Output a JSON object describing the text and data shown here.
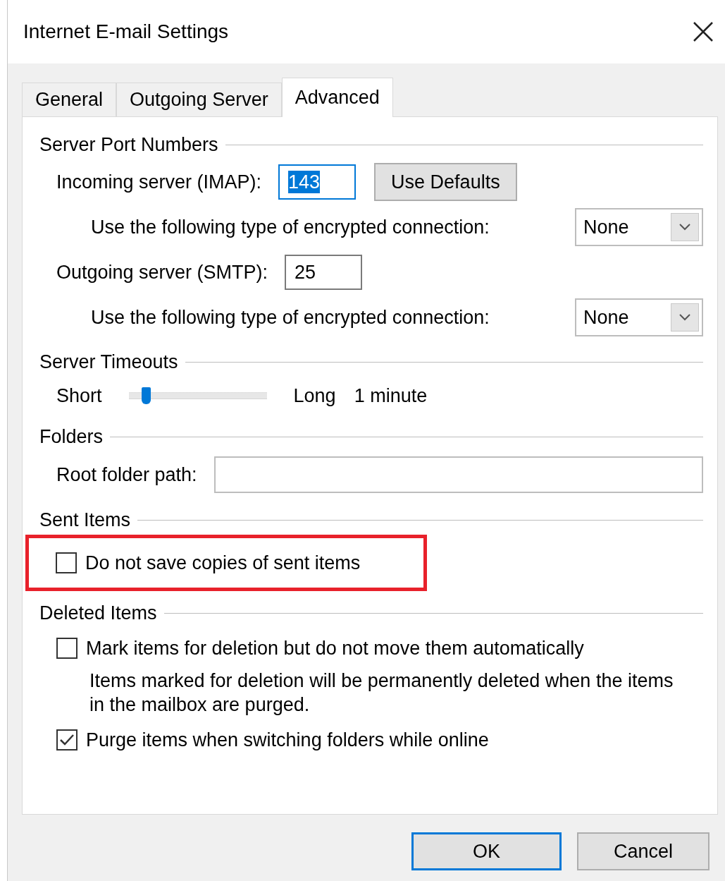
{
  "window": {
    "title": "Internet E-mail Settings"
  },
  "tabs": [
    {
      "label": "General",
      "selected": false
    },
    {
      "label": "Outgoing Server",
      "selected": false
    },
    {
      "label": "Advanced",
      "selected": true
    }
  ],
  "sections": [
    {
      "title": "Server Port Numbers",
      "rows": [
        {
          "kind": "port",
          "label": "Incoming server (IMAP):",
          "value": "143",
          "value_selected": true,
          "button": "Use Defaults"
        },
        {
          "kind": "select",
          "label": "Use the following type of encrypted connection:",
          "value": "None"
        },
        {
          "kind": "port",
          "label": "Outgoing server (SMTP):",
          "value": "25",
          "value_selected": false
        },
        {
          "kind": "select",
          "label": "Use the following type of encrypted connection:",
          "value": "None"
        }
      ]
    },
    {
      "title": "Server Timeouts",
      "rows": [
        {
          "kind": "slider",
          "min_label": "Short",
          "max_label": "Long",
          "reading": "1 minute",
          "level": 0.1
        }
      ]
    },
    {
      "title": "Folders",
      "rows": [
        {
          "kind": "text",
          "label": "Root folder path:"
        }
      ]
    },
    {
      "title": "Sent Items",
      "rows": [
        {
          "kind": "checkbox",
          "label": "Do not save copies of sent items",
          "checked": false,
          "highlighted": true
        }
      ]
    },
    {
      "title": "Deleted Items",
      "rows": [
        {
          "kind": "checkbox",
          "label": "Mark items for deletion but do not move them automatically",
          "checked": false,
          "highlighted": false
        },
        {
          "kind": "note",
          "text": "Items marked for deletion will be permanently deleted when the items in the mailbox are purged."
        },
        {
          "kind": "checkbox",
          "label": "Purge items when switching folders while online",
          "checked": true,
          "highlighted": false
        }
      ]
    }
  ],
  "buttons": [
    {
      "label": "OK",
      "default": true
    },
    {
      "label": "Cancel",
      "default": false
    }
  ]
}
